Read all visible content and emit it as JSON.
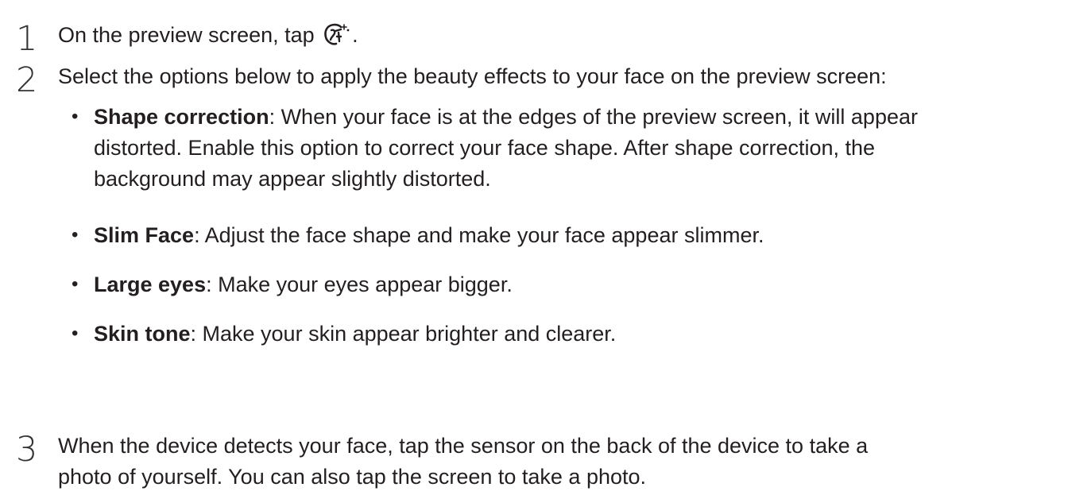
{
  "steps": [
    {
      "number": "1",
      "text_before": "On the preview screen, tap ",
      "icon": "beauty-face-icon",
      "text_after": "."
    },
    {
      "number": "2",
      "text": "Select the options below to apply the beauty effects to your face on the preview screen:"
    },
    {
      "number": "3",
      "lines": [
        "When the device detects your face, tap the sensor on the back of the device to take a",
        "photo of yourself. You can also tap the screen to take a photo."
      ]
    }
  ],
  "bullet_symbol": "•",
  "options": [
    {
      "term": "Shape correction",
      "lines": [
        ": When your face is at the edges of the preview screen, it will appear",
        "distorted. Enable this option to correct your face shape. After shape correction, the",
        "background may appear slightly distorted."
      ]
    },
    {
      "term": "Slim Face",
      "lines": [
        ": Adjust the face shape and make your face appear slimmer."
      ]
    },
    {
      "term": "Large eyes",
      "lines": [
        ": Make your eyes appear bigger."
      ]
    },
    {
      "term": "Skin tone",
      "lines": [
        ": Make your skin appear brighter and clearer."
      ]
    }
  ]
}
